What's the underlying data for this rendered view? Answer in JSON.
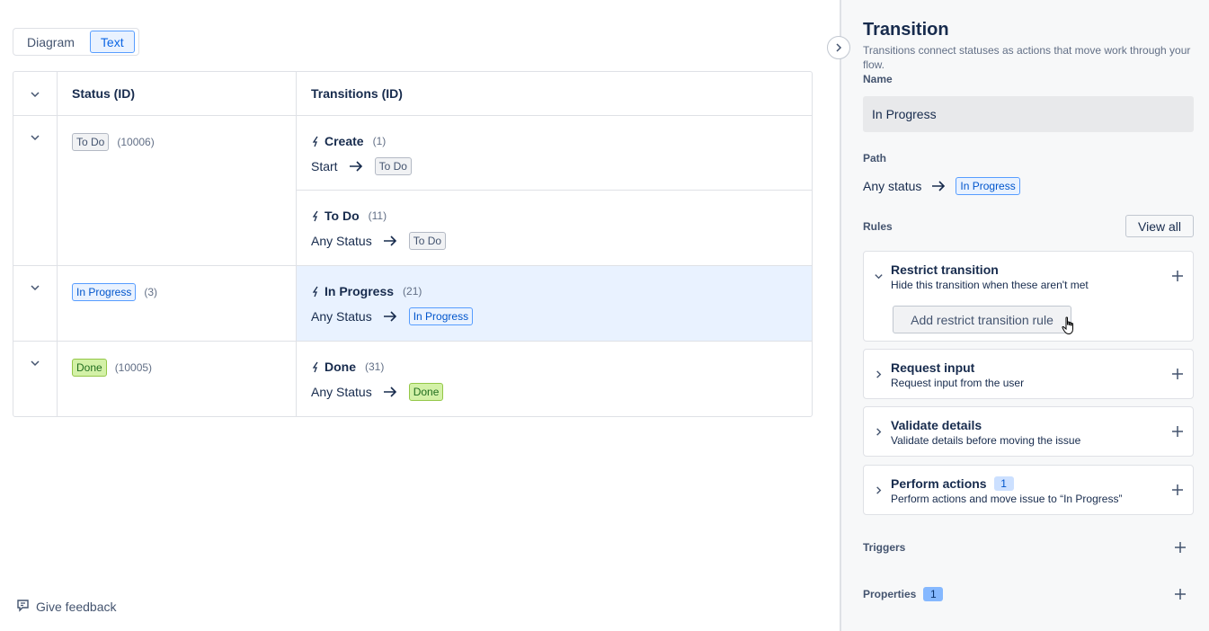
{
  "view_toggle": {
    "diagram": "Diagram",
    "text": "Text",
    "selected": "Text"
  },
  "table": {
    "headers": {
      "status": "Status (ID)",
      "transitions": "Transitions (ID)"
    },
    "rows": [
      {
        "status": "To Do",
        "status_id": "(10006)",
        "color": "grey",
        "transitions": [
          {
            "name": "Create",
            "id": "(1)",
            "from": "Start",
            "to": "To Do",
            "to_color": "grey"
          },
          {
            "name": "To Do",
            "id": "(11)",
            "from": "Any Status",
            "to": "To Do",
            "to_color": "grey"
          }
        ]
      },
      {
        "status": "In Progress",
        "status_id": "(3)",
        "color": "blue",
        "transitions": [
          {
            "name": "In Progress",
            "id": "(21)",
            "from": "Any Status",
            "to": "In Progress",
            "to_color": "blue",
            "selected": true
          }
        ]
      },
      {
        "status": "Done",
        "status_id": "(10005)",
        "color": "green",
        "transitions": [
          {
            "name": "Done",
            "id": "(31)",
            "from": "Any Status",
            "to": "Done",
            "to_color": "green"
          }
        ]
      }
    ]
  },
  "feedback": {
    "label": "Give feedback",
    "icon": "feedback-icon"
  },
  "panel": {
    "title": "Transition",
    "description": "Transitions connect statuses as actions that move work through your flow.",
    "name_label": "Name",
    "name_value": "In Progress",
    "path_label": "Path",
    "path_from": "Any status",
    "path_to": "In Progress",
    "rules_label": "Rules",
    "view_all": "View all",
    "rules": [
      {
        "title": "Restrict transition",
        "subtitle": "Hide this transition when these aren't met",
        "expanded": true,
        "action": "Add restrict transition rule"
      },
      {
        "title": "Request input",
        "subtitle": "Request input from the user",
        "expanded": false
      },
      {
        "title": "Validate details",
        "subtitle": "Validate details before moving the issue",
        "expanded": false
      },
      {
        "title": "Perform actions",
        "subtitle": "Perform actions and move issue to “In Progress”",
        "count": "1",
        "expanded": false
      }
    ],
    "triggers_label": "Triggers",
    "properties_label": "Properties",
    "properties_count": "1"
  },
  "colors": {
    "accent": "#0c66e4",
    "selected_row": "#e9f2ff",
    "panel_bg": "#f7f8f9",
    "green": "#d3f1a7",
    "blue": "#e9f2ff"
  }
}
